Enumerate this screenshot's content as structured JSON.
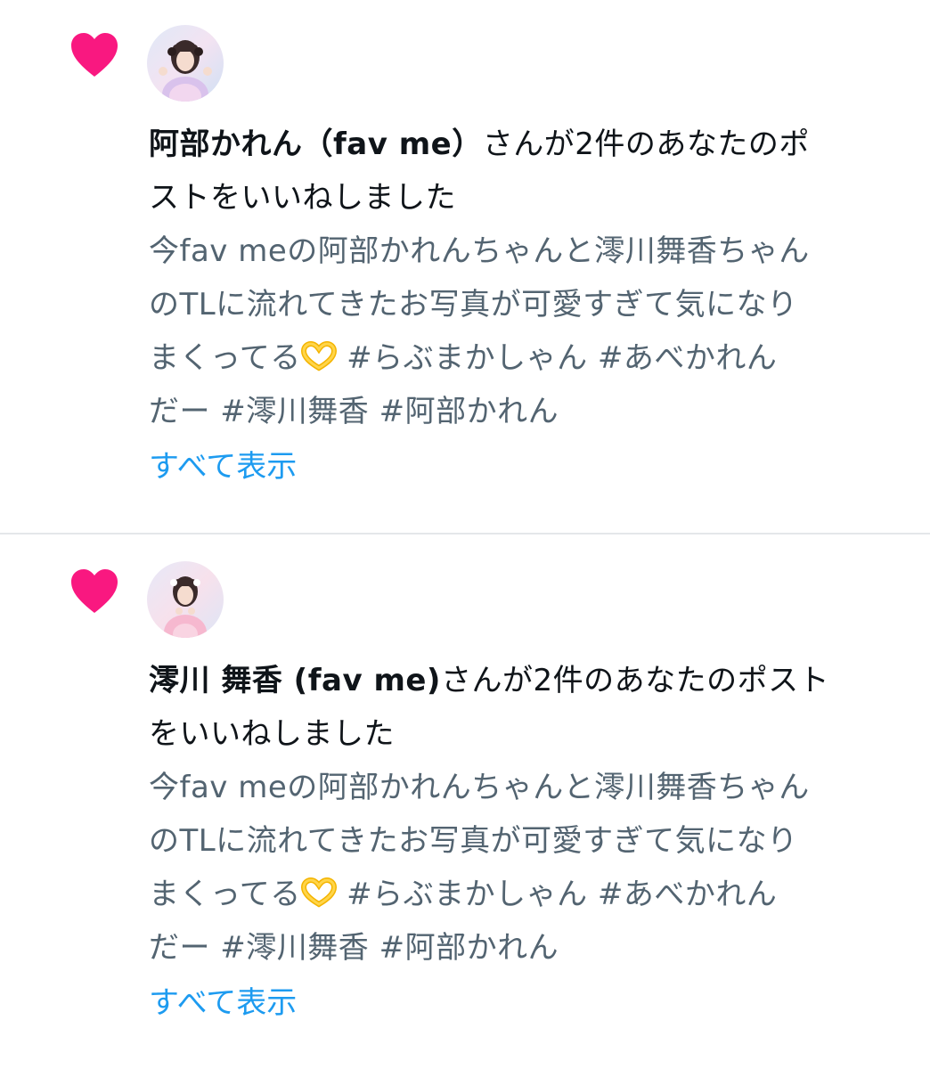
{
  "notifications": [
    {
      "name": "阿部かれん（fav me）",
      "action": "さんが2件のあなたのポストをいいねしました",
      "headline_line1_action": "さんが2件のあなたのポ",
      "headline_line2": "ストをいいねしました",
      "preview_lines": [
        "今fav meの阿部かれんちゃんと澪川舞香ちゃん",
        "のTLに流れてきたお写真が可愛すぎて気になり",
        "まくってる",
        " #らぶまかしゃん  #あべかれん",
        "だー  #澪川舞香  #阿部かれん"
      ],
      "show_all": "すべて表示"
    },
    {
      "name": "澪川 舞香 (fav me)",
      "action": "さんが2件のあなたのポストをいいねしました",
      "headline_line1_action": "さんが2件のあなたのポスト",
      "headline_line2": "をいいねしました",
      "preview_lines": [
        "今fav meの阿部かれんちゃんと澪川舞香ちゃん",
        "のTLに流れてきたお写真が可愛すぎて気になり",
        "まくってる",
        " #らぶまかしゃん  #あべかれん",
        "だー  #澪川舞香  #阿部かれん"
      ],
      "show_all": "すべて表示"
    }
  ],
  "colors": {
    "heart": "#f91880",
    "link": "#1d9bf0",
    "text_primary": "#0f1419",
    "text_secondary": "#536471",
    "divider": "#e4e7ea"
  },
  "icons": {
    "like": "heart-icon",
    "emoji": "heart-hands-emoji"
  }
}
